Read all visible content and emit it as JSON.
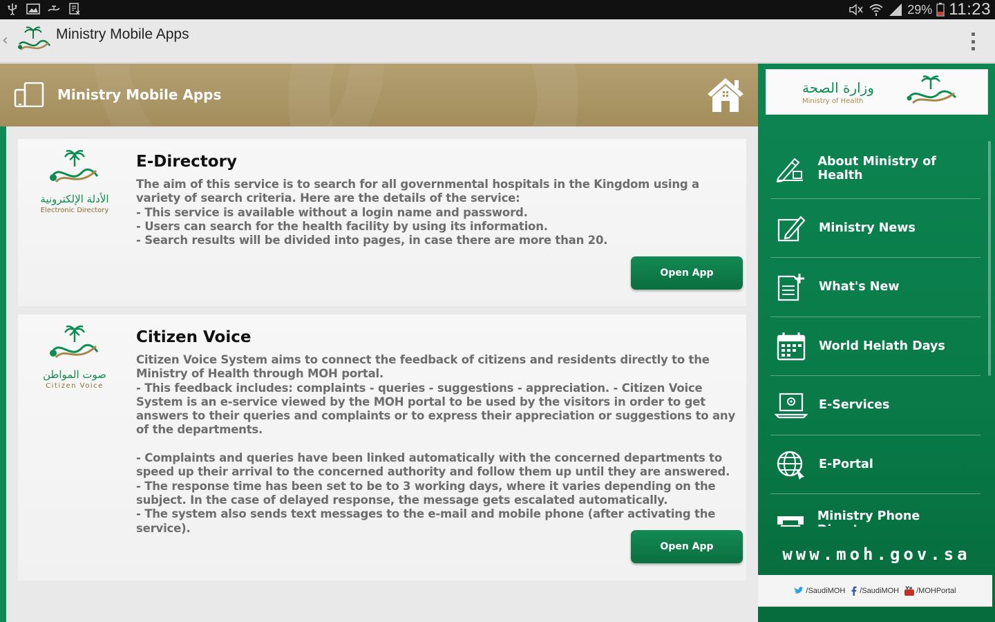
{
  "status_bar": {
    "battery_pct": "29%",
    "time": "11:23"
  },
  "action_bar": {
    "back_glyph": "‹",
    "title": "Ministry Mobile Apps"
  },
  "banner": {
    "title": "Ministry Mobile Apps"
  },
  "cards": [
    {
      "logo_ar": "الأدلة الإلكترونية",
      "logo_en": "Electronic Directory",
      "title": "E-Directory",
      "text": "The aim of this service is to search for all governmental hospitals in the Kingdom using a variety of search criteria. Here are the details of the service:\n- This service is available without a login name and password.\n- Users can search for the health facility by using its information.\n- Search results will be divided into pages, in case there are more than 20.",
      "button": "Open App"
    },
    {
      "logo_ar": "صوت المواطن",
      "logo_en": "Citizen Voice",
      "title": "Citizen Voice",
      "text": "Citizen Voice System aims to connect the feedback of citizens and residents directly to the Ministry of Health through MOH portal.\n- This feedback includes: complaints - queries - suggestions - appreciation. - Citizen Voice System is an e-service viewed by the MOH portal to be used by the visitors in order to get answers to their queries and complaints or to express their appreciation or suggestions to any of the departments.\n\n- Complaints and queries have been linked automatically with the concerned departments to speed up their arrival to the concerned authority and follow them up until they are answered.\n- The response time has been set to be to 3 working days, where it varies depending on the subject. In the case of delayed response, the message gets escalated automatically.\n- The system also sends text messages to the e-mail and mobile phone (after activating the service).",
      "button": "Open App"
    }
  ],
  "sidebar": {
    "logo_ar": "وزارة الصحة",
    "logo_en": "Ministry of Health",
    "items": [
      {
        "label": "About Ministry of Health",
        "icon": "pen-icon"
      },
      {
        "label": "Ministry News",
        "icon": "edit-icon"
      },
      {
        "label": "What's New",
        "icon": "document-add-icon"
      },
      {
        "label": "World Helath Days",
        "icon": "calendar-icon"
      },
      {
        "label": "E-Services",
        "icon": "laptop-icon"
      },
      {
        "label": "E-Portal",
        "icon": "globe-icon"
      },
      {
        "label": "Ministry Phone Directory",
        "icon": "phone-icon"
      }
    ],
    "url": "www.moh.gov.sa",
    "social": {
      "twitter": "/SaudiMOH",
      "facebook": "/SaudiMOH",
      "youtube": "/MOHPortal"
    }
  },
  "colors": {
    "green": "#0c8552",
    "gold": "#a8925f",
    "button_green": "#0f7d4a"
  }
}
